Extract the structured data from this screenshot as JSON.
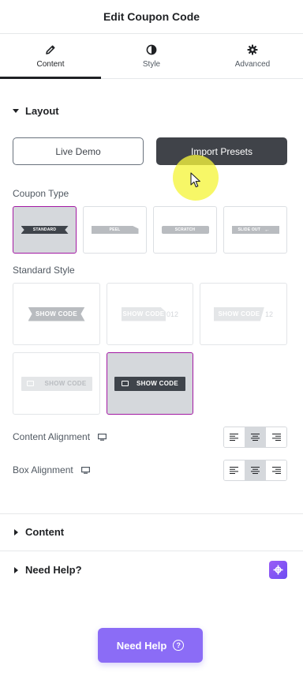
{
  "header": {
    "title": "Edit Coupon Code"
  },
  "tabs": [
    {
      "label": "Content",
      "icon": "pencil-icon",
      "active": true
    },
    {
      "label": "Style",
      "icon": "half-circle-icon",
      "active": false
    },
    {
      "label": "Advanced",
      "icon": "gear-icon",
      "active": false
    }
  ],
  "layout": {
    "title": "Layout",
    "live_demo_label": "Live Demo",
    "import_presets_label": "Import Presets",
    "coupon_type_label": "Coupon Type",
    "coupon_types": [
      {
        "text": "STANDARD",
        "selected": true
      },
      {
        "text": "PEEL",
        "selected": false
      },
      {
        "text": "SCRATCH",
        "selected": false
      },
      {
        "text": "SLIDE OUT",
        "selected": false
      }
    ],
    "standard_style_label": "Standard Style",
    "standard_styles": [
      {
        "text": "SHOW CODE",
        "tail": "",
        "selected": false
      },
      {
        "text": "SHOW CODE",
        "tail": "012",
        "selected": false
      },
      {
        "text": "SHOW CODE",
        "tail": "12",
        "selected": false
      },
      {
        "text": "SHOW CODE",
        "tail": "",
        "selected": false
      },
      {
        "text": "SHOW CODE",
        "tail": "",
        "selected": true
      }
    ],
    "content_alignment_label": "Content Alignment",
    "box_alignment_label": "Box Alignment",
    "content_alignment_value": "center",
    "box_alignment_value": "center"
  },
  "content_section": {
    "title": "Content"
  },
  "need_help_section": {
    "title": "Need Help?"
  },
  "need_help_button": {
    "label": "Need Help",
    "icon_text": "?"
  },
  "colors": {
    "accent_selected_border": "#a319a3",
    "dark_button": "#404349",
    "help_button": "#8b6cf6",
    "cursor_highlight": "#f5f53c"
  }
}
